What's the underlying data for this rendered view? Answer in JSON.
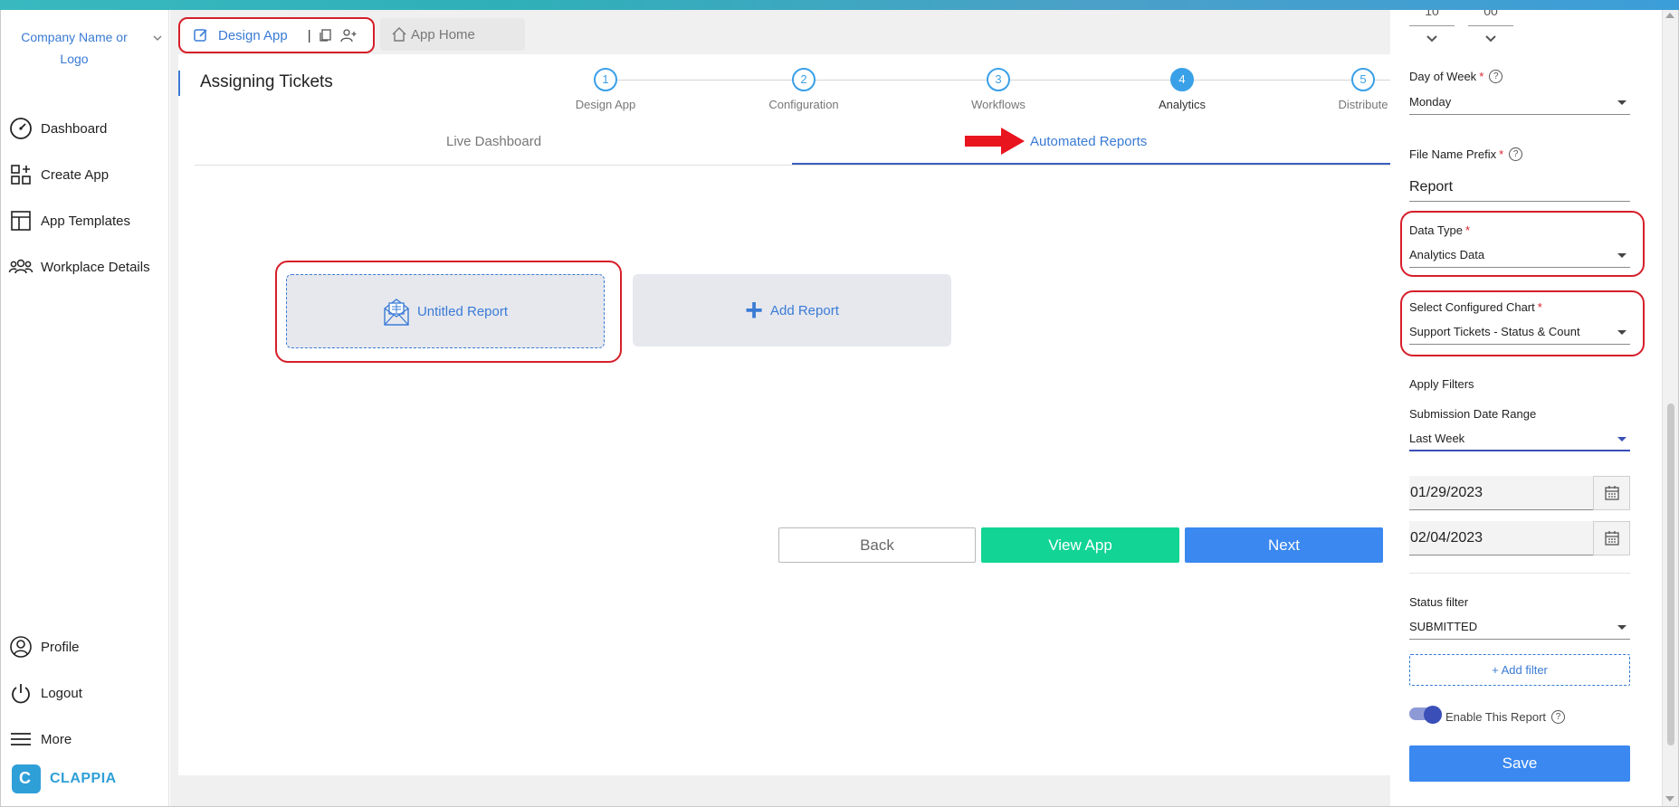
{
  "sidebar": {
    "company": "Company Name or Logo",
    "items": [
      {
        "label": "Dashboard",
        "icon": "speedometer-icon"
      },
      {
        "label": "Create App",
        "icon": "grid-plus-icon"
      },
      {
        "label": "App Templates",
        "icon": "template-icon"
      },
      {
        "label": "Workplace Details",
        "icon": "team-icon"
      }
    ],
    "bottom_items": [
      {
        "label": "Profile",
        "icon": "user-circle-icon"
      },
      {
        "label": "Logout",
        "icon": "power-icon"
      },
      {
        "label": "More",
        "icon": "menu-icon"
      }
    ],
    "logo_text": "CLAPPIA"
  },
  "tabs": {
    "design_app": "Design App",
    "app_home": "App Home"
  },
  "app_title": "Assigning Tickets",
  "stepper": [
    {
      "num": "1",
      "label": "Design App"
    },
    {
      "num": "2",
      "label": "Configuration"
    },
    {
      "num": "3",
      "label": "Workflows"
    },
    {
      "num": "4",
      "label": "Analytics",
      "active": true
    },
    {
      "num": "5",
      "label": "Distribute"
    }
  ],
  "subtabs": {
    "live": "Live Dashboard",
    "automated": "Automated Reports"
  },
  "reports": {
    "untitled": "Untitled Report",
    "add": "Add Report",
    "add_symbol": "+"
  },
  "buttons": {
    "back": "Back",
    "view_app": "View App",
    "next": "Next"
  },
  "panel": {
    "time_hour": "10",
    "time_min": "00",
    "day_of_week_label": "Day of Week",
    "day_of_week_value": "Monday",
    "file_prefix_label": "File Name Prefix",
    "file_prefix_value": "Report",
    "data_type_label": "Data Type",
    "data_type_value": "Analytics Data",
    "chart_label": "Select Configured Chart",
    "chart_value": "Support Tickets - Status & Count",
    "apply_filters": "Apply Filters",
    "date_range_label": "Submission Date Range",
    "date_range_value": "Last Week",
    "date_from": "01/29/2023",
    "date_to": "02/04/2023",
    "status_label": "Status filter",
    "status_value": "SUBMITTED",
    "add_filter": "+ Add filter",
    "enable_label": "Enable This Report",
    "enable_on": true,
    "save": "Save",
    "required_mark": "*",
    "help_mark": "?"
  },
  "colors": {
    "accent": "#3a7bd5",
    "highlight": "#d61f2a",
    "view_app": "#12d494",
    "primary_btn": "#3a88f0"
  }
}
